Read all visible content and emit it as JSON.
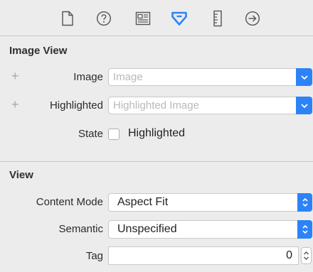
{
  "toolbar": {
    "icons": [
      "file-icon",
      "help-icon",
      "identity-icon",
      "attributes-icon",
      "size-icon",
      "connections-icon"
    ],
    "accent": "#2c83f7"
  },
  "image_view": {
    "header": "Image View",
    "image": {
      "label": "Image",
      "placeholder": "Image"
    },
    "highlighted": {
      "label": "Highlighted",
      "placeholder": "Highlighted Image"
    },
    "state": {
      "label": "State",
      "checkbox_label": "Highlighted",
      "checked": false
    }
  },
  "view": {
    "header": "View",
    "content_mode": {
      "label": "Content Mode",
      "value": "Aspect Fit"
    },
    "semantic": {
      "label": "Semantic",
      "value": "Unspecified"
    },
    "tag": {
      "label": "Tag",
      "value": "0"
    }
  }
}
